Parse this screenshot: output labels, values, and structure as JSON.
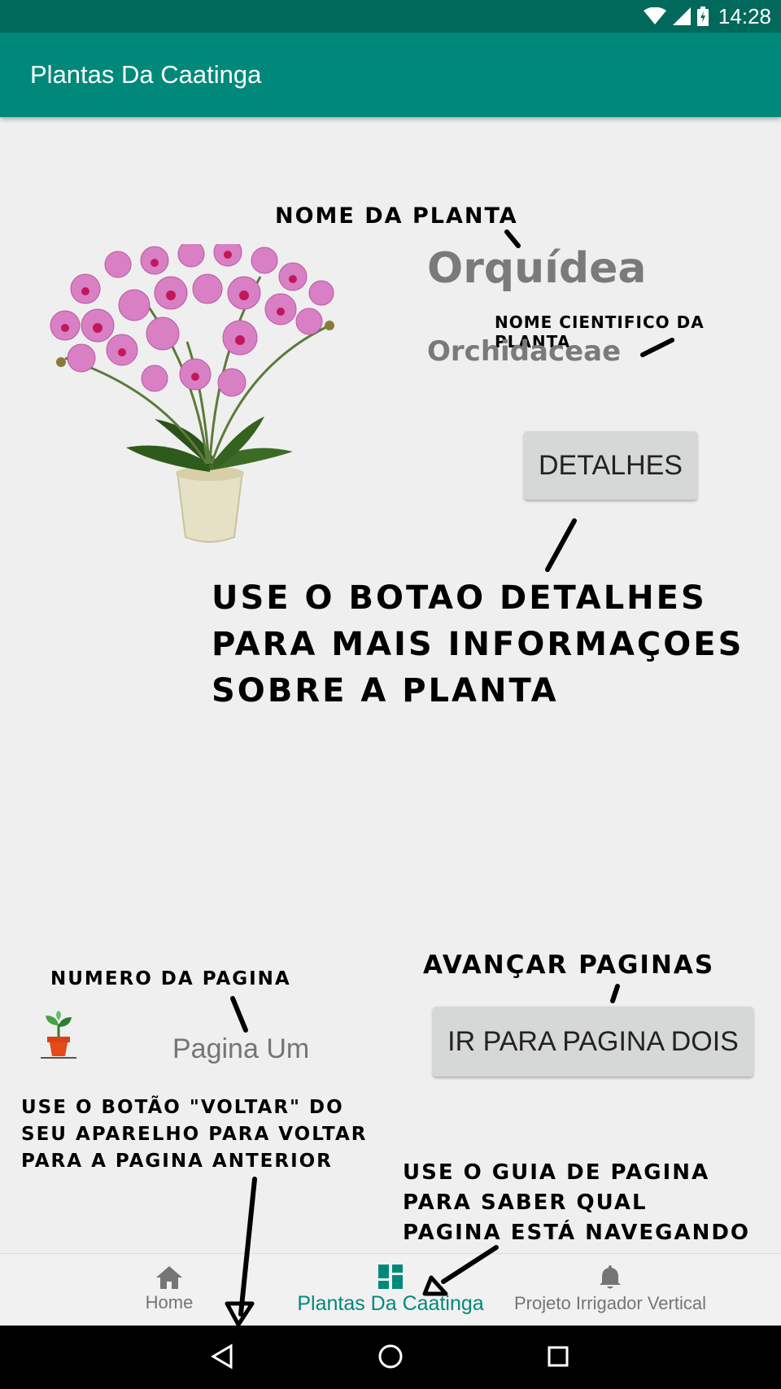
{
  "status_bar": {
    "time": "14:28"
  },
  "app_bar": {
    "title": "Plantas Da Caatinga"
  },
  "plant": {
    "name": "Orquídea",
    "scientific_name": "Orchidaceae",
    "details_button": "DETALHES"
  },
  "annotations": {
    "plant_name": "NOME DA PLANTA",
    "scientific_name": "NOME CIENTIFICO DA PLANTA",
    "details_hint": "USE O BOTAO DETALHES\nPARA MAIS INFORMAÇOES\nSOBRE A PLANTA",
    "page_number": "NUMERO DA PAGINA",
    "next_pages": "AVANÇAR PAGINAS",
    "back_hint": "USE O BOTÃO \"VOLTAR\" DO\nSEU APARELHO PARA VOLTAR\nPARA A PAGINA ANTERIOR",
    "guide_hint": "USE O GUIA DE PAGINA\nPARA SABER QUAL\nPAGINA ESTÁ NAVEGANDO"
  },
  "pager": {
    "label": "Pagina Um",
    "next_button": "IR PARA PAGINA DOIS"
  },
  "bottom_nav": {
    "items": [
      {
        "label": "Home",
        "icon": "home-icon",
        "active": false
      },
      {
        "label": "Plantas Da Caatinga",
        "icon": "dashboard-icon",
        "active": true
      },
      {
        "label": "Projeto Irrigador Vertical",
        "icon": "bell-icon",
        "active": false
      }
    ]
  },
  "colors": {
    "primary": "#00897b",
    "primary_dark": "#00695c",
    "background": "#efefef"
  }
}
